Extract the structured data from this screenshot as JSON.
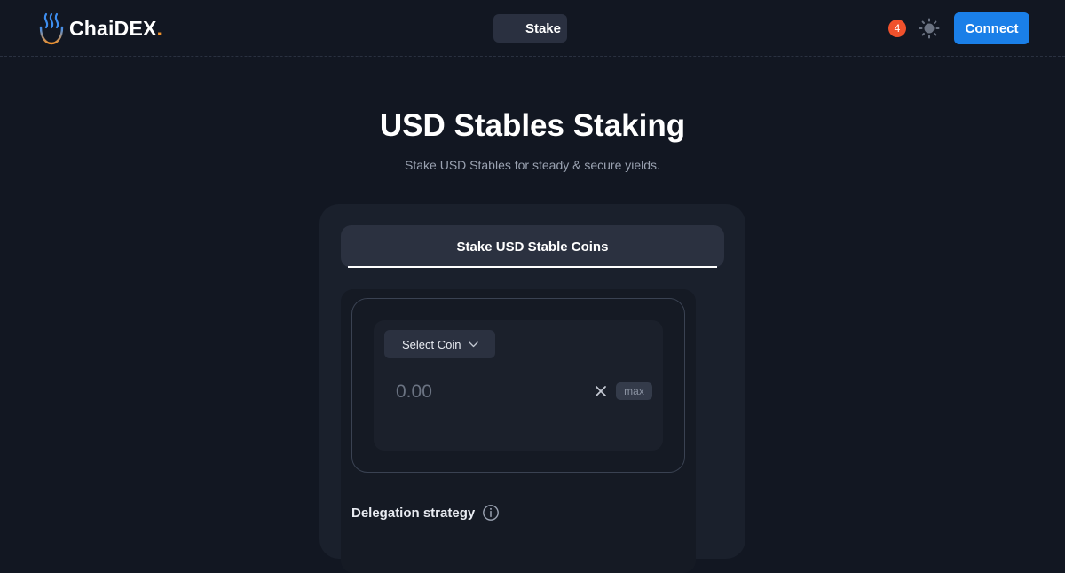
{
  "header": {
    "logo_text": "ChaiDEX",
    "logo_dot": ".",
    "nav_stake_label": "Stake",
    "notification_count": "4",
    "connect_label": "Connect",
    "icons": {
      "logo": "flame-logo-icon",
      "theme": "sun-icon"
    },
    "colors": {
      "accent": "#1a7fe8",
      "logo_dot": "#f0912b",
      "badge": "#f0512c"
    }
  },
  "page": {
    "title": "USD Stables Staking",
    "subtitle": "Stake USD Stables for steady & secure yields."
  },
  "card": {
    "tab_label": "Stake USD Stable Coins",
    "select_coin_label": "Select Coin",
    "amount_placeholder": "0.00",
    "max_label": "max",
    "delegation_label": "Delegation strategy",
    "icons": {
      "select_chevron": "chevron-down-icon",
      "clear": "close-icon",
      "delegation_info": "info-icon"
    }
  }
}
